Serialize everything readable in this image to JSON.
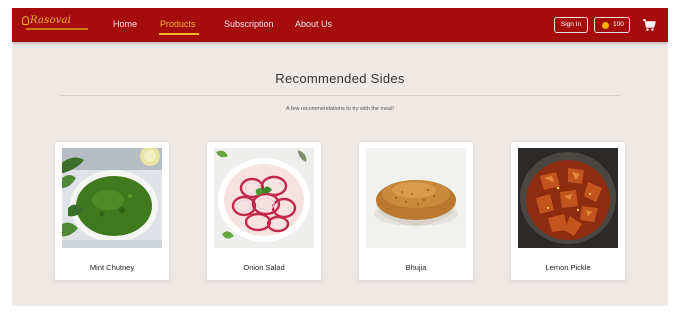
{
  "nav": {
    "brand": "Rasovai",
    "links": [
      {
        "label": "Home",
        "active": false
      },
      {
        "label": "Products",
        "active": true
      },
      {
        "label": "Subscription",
        "active": false
      },
      {
        "label": "About Us",
        "active": false
      }
    ],
    "signin_label": "Sign In",
    "coins": "100",
    "cart_icon": "cart-icon"
  },
  "section": {
    "title": "Recommended Sides",
    "subtitle": "A few recommendations to try with the meal!"
  },
  "products": [
    {
      "name": "Mint Chutney"
    },
    {
      "name": "Onion Salad"
    },
    {
      "name": "Bhujia"
    },
    {
      "name": "Lemon Pickle"
    }
  ],
  "colors": {
    "navbar": "#a50d0d",
    "accent": "#f0b429",
    "page_bg": "#efe9e6"
  }
}
